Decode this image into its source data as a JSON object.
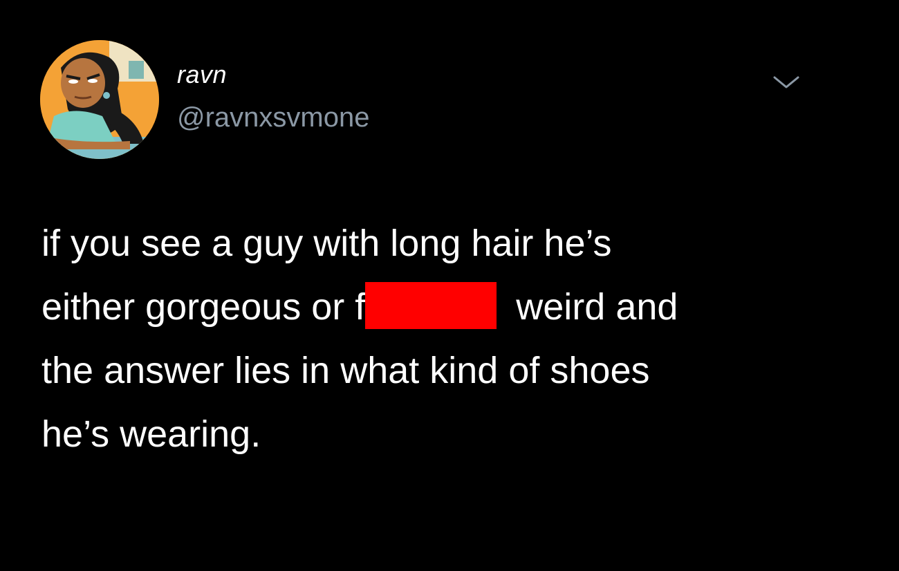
{
  "author": {
    "display_name": "ravn",
    "handle": "@ravnxsvmone",
    "avatar_icon": "cartoon-avatar-icon"
  },
  "menu": {
    "icon": "chevron-down-icon"
  },
  "tweet": {
    "lines": [
      "if you see a guy with long hair he’s",
      "either gorgeous or f",
      "weird and",
      "the answer lies in what kind of shoes",
      "he’s wearing."
    ],
    "redaction_color": "#ff0000"
  },
  "colors": {
    "background": "#000000",
    "text": "#ffffff",
    "handle": "#8b98a5"
  }
}
